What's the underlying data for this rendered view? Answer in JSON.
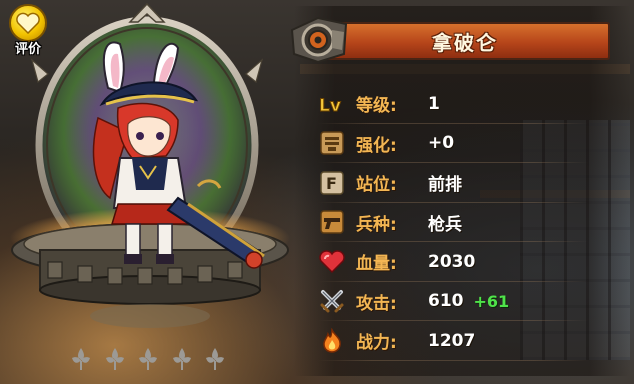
{
  "rating": {
    "label": "评价"
  },
  "hero": {
    "name": "拿破仑"
  },
  "stats": [
    {
      "key": "level",
      "icon": "lv-badge-icon",
      "icon_text": "Lv",
      "label": "等级:",
      "value": "1",
      "bonus": ""
    },
    {
      "key": "enhance",
      "icon": "anvil-icon",
      "icon_text": "",
      "label": "强化:",
      "value": "+0",
      "bonus": ""
    },
    {
      "key": "position",
      "icon": "position-f-icon",
      "icon_text": "F",
      "label": "站位:",
      "value": "前排",
      "bonus": ""
    },
    {
      "key": "class",
      "icon": "gun-icon",
      "icon_text": "",
      "label": "兵种:",
      "value": "枪兵",
      "bonus": ""
    },
    {
      "key": "hp",
      "icon": "heart-icon",
      "icon_text": "",
      "label": "血量:",
      "value": "2030",
      "bonus": ""
    },
    {
      "key": "attack",
      "icon": "crossed-swords-icon",
      "icon_text": "",
      "label": "攻击:",
      "value": "610",
      "bonus": "+61"
    },
    {
      "key": "power",
      "icon": "flame-icon",
      "icon_text": "",
      "label": "战力:",
      "value": "1207",
      "bonus": ""
    }
  ],
  "colors": {
    "label": "#f3b653",
    "value": "#ffffff",
    "bonus": "#4fe34a",
    "name_bar": "#b6451a"
  }
}
